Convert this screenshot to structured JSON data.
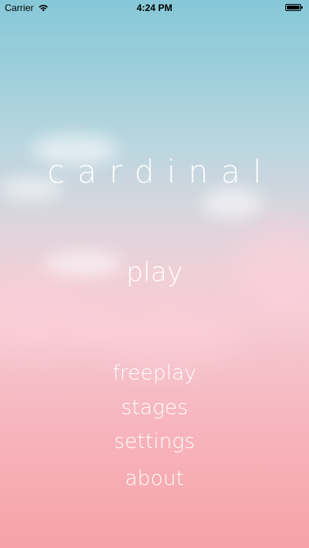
{
  "status_bar": {
    "carrier": "Carrier",
    "time": "4:24 PM",
    "battery_level": 1.0
  },
  "app": {
    "title": "cardinal"
  },
  "menu": {
    "play": "play",
    "freeplay": "freeplay",
    "stages": "stages",
    "settings": "settings",
    "about": "about"
  },
  "colors": {
    "sky_top": "#86c8d8",
    "sky_bottom": "#f6a2a6",
    "text": "#ffffff"
  }
}
